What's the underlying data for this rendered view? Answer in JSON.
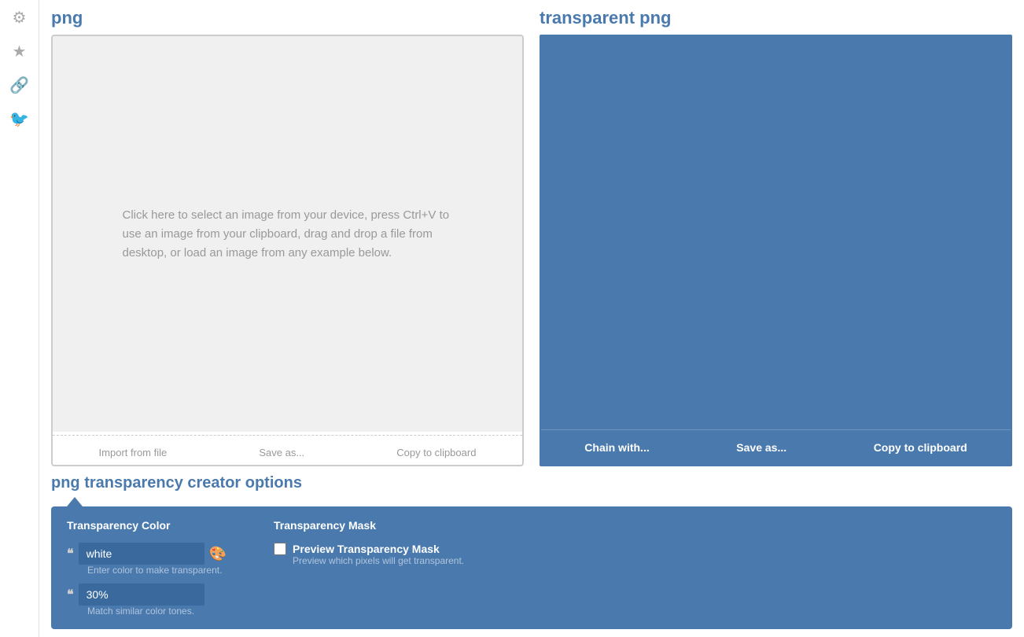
{
  "sidebar": {
    "icons": [
      {
        "name": "gear-icon",
        "symbol": "⚙"
      },
      {
        "name": "star-icon",
        "symbol": "★"
      },
      {
        "name": "link-icon",
        "symbol": "🔗"
      },
      {
        "name": "twitter-icon",
        "symbol": "🐦"
      }
    ]
  },
  "left_panel": {
    "title": "png",
    "upload_text": "Click here to select an image from your device, press Ctrl+V to use an image from your clipboard, drag and drop a file from desktop, or load an image from any example below.",
    "actions": [
      {
        "label": "Import from file"
      },
      {
        "label": "Save as..."
      },
      {
        "label": "Copy to clipboard"
      }
    ]
  },
  "right_panel": {
    "title": "transparent png",
    "actions": [
      {
        "label": "Chain with..."
      },
      {
        "label": "Save as..."
      },
      {
        "label": "Copy to clipboard"
      }
    ]
  },
  "options": {
    "section_title": "png transparency creator options",
    "transparency_color": {
      "label": "Transparency Color",
      "input_value": "white",
      "input_hint": "Enter color to make transparent.",
      "percent_value": "30%",
      "percent_hint": "Match similar color tones."
    },
    "transparency_mask": {
      "label": "Transparency Mask",
      "checkbox_label": "Preview Transparency Mask",
      "checkbox_hint": "Preview which pixels will get transparent."
    }
  }
}
